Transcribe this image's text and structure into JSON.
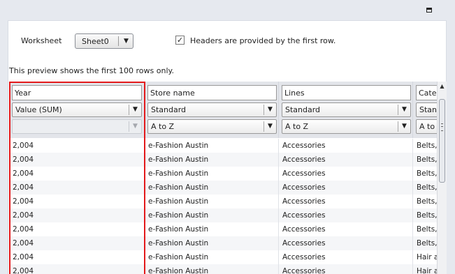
{
  "window": {
    "restore_icon": "restore-window-icon"
  },
  "worksheet": {
    "label": "Worksheet",
    "selected": "Sheet0",
    "arrow_icon": "chevron-down-icon"
  },
  "headers_checkbox": {
    "checked": true,
    "check_mark": "✓",
    "label": "Headers are provided by the first row."
  },
  "preview_note": "This preview shows the first 100 rows only.",
  "columns": [
    {
      "name": "Year",
      "aggregation": "Value (SUM)",
      "sort": "",
      "rows": [
        "2,004",
        "2,004",
        "2,004",
        "2,004",
        "2,004",
        "2,004",
        "2,004",
        "2,004",
        "2,004",
        "2,004"
      ]
    },
    {
      "name": "Store name",
      "aggregation": "Standard",
      "sort": "A to Z",
      "rows": [
        "e-Fashion Austin",
        "e-Fashion Austin",
        "e-Fashion Austin",
        "e-Fashion Austin",
        "e-Fashion Austin",
        "e-Fashion Austin",
        "e-Fashion Austin",
        "e-Fashion Austin",
        "e-Fashion Austin",
        "e-Fashion Austin"
      ]
    },
    {
      "name": "Lines",
      "aggregation": "Standard",
      "sort": "A to Z",
      "rows": [
        "Accessories",
        "Accessories",
        "Accessories",
        "Accessories",
        "Accessories",
        "Accessories",
        "Accessories",
        "Accessories",
        "Accessories",
        "Accessories"
      ]
    },
    {
      "name": "Cate",
      "aggregation": "Stan",
      "sort": "A to",
      "rows": [
        "Belts,",
        "Belts,",
        "Belts,",
        "Belts,",
        "Belts,",
        "Belts,",
        "Belts,",
        "Belts,",
        "Hair a",
        "Hair a"
      ]
    }
  ],
  "scrollbar": {
    "up_icon": "▲"
  }
}
